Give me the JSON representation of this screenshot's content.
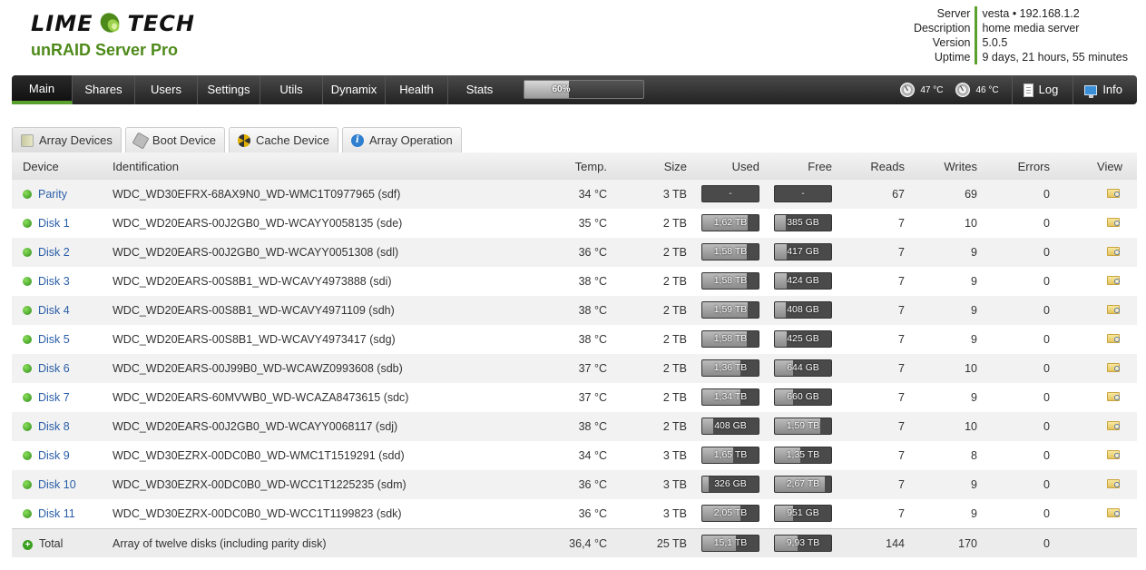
{
  "brand": {
    "name_left": "LIME",
    "name_right": "TECH",
    "product": "unRAID Server Pro"
  },
  "server_info": {
    "labels": [
      "Server",
      "Description",
      "Version",
      "Uptime"
    ],
    "values": [
      "vesta • 192.168.1.2",
      "home media server",
      "5.0.5",
      "9 days, 21 hours, 55 minutes"
    ]
  },
  "nav": {
    "items": [
      "Main",
      "Shares",
      "Users",
      "Settings",
      "Utils",
      "Dynamix",
      "Health",
      "Stats"
    ],
    "progress": {
      "label": "60%",
      "value": 0.6
    },
    "temps": [
      "47 °C",
      "46 °C"
    ],
    "log_label": "Log",
    "info_label": "Info"
  },
  "tabs": [
    "Array Devices",
    "Boot Device",
    "Cache Device",
    "Array Operation"
  ],
  "table": {
    "headers": [
      "Device",
      "Identification",
      "Temp.",
      "Size",
      "Used",
      "Free",
      "Reads",
      "Writes",
      "Errors",
      "View"
    ],
    "rows": [
      {
        "device": "Parity",
        "id": "WDC_WD30EFRX-68AX9N0_WD-WMC1T0977965 (sdf)",
        "temp": "34 °C",
        "size": "3 TB",
        "used": "-",
        "used_frac": 0,
        "free": "-",
        "free_frac": 0,
        "reads": "67",
        "writes": "69",
        "errors": "0"
      },
      {
        "device": "Disk 1",
        "id": "WDC_WD20EARS-00J2GB0_WD-WCAYY0058135 (sde)",
        "temp": "35 °C",
        "size": "2 TB",
        "used": "1,62 TB",
        "used_frac": 0.81,
        "free": "385 GB",
        "free_frac": 0.19,
        "reads": "7",
        "writes": "10",
        "errors": "0"
      },
      {
        "device": "Disk 2",
        "id": "WDC_WD20EARS-00J2GB0_WD-WCAYY0051308 (sdl)",
        "temp": "36 °C",
        "size": "2 TB",
        "used": "1,58 TB",
        "used_frac": 0.79,
        "free": "417 GB",
        "free_frac": 0.21,
        "reads": "7",
        "writes": "9",
        "errors": "0"
      },
      {
        "device": "Disk 3",
        "id": "WDC_WD20EARS-00S8B1_WD-WCAVY4973888 (sdi)",
        "temp": "38 °C",
        "size": "2 TB",
        "used": "1,58 TB",
        "used_frac": 0.79,
        "free": "424 GB",
        "free_frac": 0.21,
        "reads": "7",
        "writes": "9",
        "errors": "0"
      },
      {
        "device": "Disk 4",
        "id": "WDC_WD20EARS-00S8B1_WD-WCAVY4971109 (sdh)",
        "temp": "38 °C",
        "size": "2 TB",
        "used": "1,59 TB",
        "used_frac": 0.8,
        "free": "408 GB",
        "free_frac": 0.2,
        "reads": "7",
        "writes": "9",
        "errors": "0"
      },
      {
        "device": "Disk 5",
        "id": "WDC_WD20EARS-00S8B1_WD-WCAVY4973417 (sdg)",
        "temp": "38 °C",
        "size": "2 TB",
        "used": "1,58 TB",
        "used_frac": 0.79,
        "free": "425 GB",
        "free_frac": 0.21,
        "reads": "7",
        "writes": "9",
        "errors": "0"
      },
      {
        "device": "Disk 6",
        "id": "WDC_WD20EARS-00J99B0_WD-WCAWZ0993608 (sdb)",
        "temp": "37 °C",
        "size": "2 TB",
        "used": "1,36 TB",
        "used_frac": 0.68,
        "free": "644 GB",
        "free_frac": 0.32,
        "reads": "7",
        "writes": "10",
        "errors": "0"
      },
      {
        "device": "Disk 7",
        "id": "WDC_WD20EARS-60MVWB0_WD-WCAZA8473615 (sdc)",
        "temp": "37 °C",
        "size": "2 TB",
        "used": "1,34 TB",
        "used_frac": 0.67,
        "free": "660 GB",
        "free_frac": 0.33,
        "reads": "7",
        "writes": "9",
        "errors": "0"
      },
      {
        "device": "Disk 8",
        "id": "WDC_WD20EARS-00J2GB0_WD-WCAYY0068117 (sdj)",
        "temp": "38 °C",
        "size": "2 TB",
        "used": "408 GB",
        "used_frac": 0.2,
        "free": "1,59 TB",
        "free_frac": 0.8,
        "reads": "7",
        "writes": "10",
        "errors": "0"
      },
      {
        "device": "Disk 9",
        "id": "WDC_WD30EZRX-00DC0B0_WD-WMC1T1519291 (sdd)",
        "temp": "34 °C",
        "size": "3 TB",
        "used": "1,65 TB",
        "used_frac": 0.55,
        "free": "1,35 TB",
        "free_frac": 0.45,
        "reads": "7",
        "writes": "8",
        "errors": "0"
      },
      {
        "device": "Disk 10",
        "id": "WDC_WD30EZRX-00DC0B0_WD-WCC1T1225235 (sdm)",
        "temp": "36 °C",
        "size": "3 TB",
        "used": "326 GB",
        "used_frac": 0.11,
        "free": "2,67 TB",
        "free_frac": 0.89,
        "reads": "7",
        "writes": "9",
        "errors": "0"
      },
      {
        "device": "Disk 11",
        "id": "WDC_WD30EZRX-00DC0B0_WD-WCC1T1199823 (sdk)",
        "temp": "36 °C",
        "size": "3 TB",
        "used": "2,05 TB",
        "used_frac": 0.68,
        "free": "951 GB",
        "free_frac": 0.32,
        "reads": "7",
        "writes": "9",
        "errors": "0"
      }
    ],
    "total": {
      "device": "Total",
      "id": "Array of twelve disks (including parity disk)",
      "temp": "36,4 °C",
      "size": "25 TB",
      "used": "15,1 TB",
      "used_frac": 0.6,
      "free": "9,93 TB",
      "free_frac": 0.4,
      "reads": "144",
      "writes": "170",
      "errors": "0"
    }
  },
  "colors": {
    "accent": "#5aa02c",
    "link": "#2a5ea8",
    "navbar": "#2b2b2b"
  }
}
